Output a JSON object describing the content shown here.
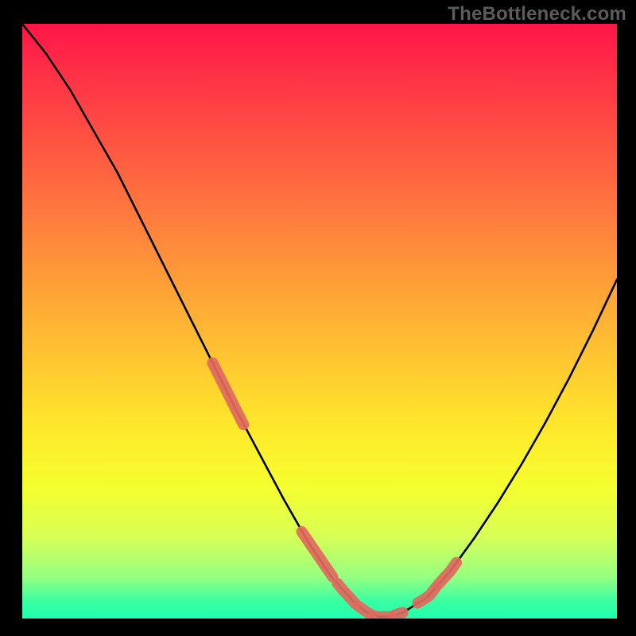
{
  "watermark": "TheBottleneck.com",
  "chart_data": {
    "type": "line",
    "title": "",
    "xlabel": "",
    "ylabel": "",
    "xlim": [
      0,
      100
    ],
    "ylim": [
      0,
      100
    ],
    "series": [
      {
        "name": "curve",
        "x": [
          0,
          4,
          8,
          12,
          16,
          20,
          24,
          28,
          32,
          36,
          40,
          44,
          48,
          52,
          56,
          58,
          60,
          62,
          64,
          68,
          72,
          76,
          80,
          84,
          88,
          92,
          96,
          100
        ],
        "y": [
          100,
          95,
          89,
          82,
          75,
          67,
          59,
          51,
          43,
          35,
          27.5,
          20,
          13,
          7,
          2.5,
          1,
          0.3,
          0.3,
          1,
          3.5,
          8,
          13.5,
          19.5,
          26,
          33,
          40.5,
          48.5,
          57
        ]
      },
      {
        "name": "highlight-segments",
        "segments": [
          {
            "x": [
              32.0,
              33.3,
              34.6,
              35.9,
              37.2
            ],
            "y": [
              43.0,
              40.4,
              37.8,
              35.2,
              32.6
            ]
          },
          {
            "x": [
              47.0,
              48.3,
              49.6,
              50.9,
              52.2
            ],
            "y": [
              14.6,
              12.7,
              10.8,
              8.9,
              7.0
            ]
          },
          {
            "x": [
              53.0,
              54.0,
              55.0,
              56.0
            ],
            "y": [
              5.9,
              4.7,
              3.6,
              2.5
            ]
          },
          {
            "x": [
              56.5,
              57.2,
              57.9,
              58.6
            ],
            "y": [
              2.1,
              1.6,
              1.1,
              0.7
            ]
          },
          {
            "x": [
              59.0,
              60.0,
              61.0,
              62.0
            ],
            "y": [
              0.4,
              0.3,
              0.3,
              0.3
            ]
          },
          {
            "x": [
              62.5,
              63.0,
              63.5,
              64.0
            ],
            "y": [
              0.5,
              0.7,
              0.9,
              1.0
            ]
          },
          {
            "x": [
              66.5,
              67.5,
              68.5,
              69.5
            ],
            "y": [
              2.6,
              3.2,
              3.9,
              5.2
            ]
          },
          {
            "x": [
              70.0,
              71.0,
              72.0,
              73.0
            ],
            "y": [
              5.8,
              6.9,
              8.0,
              9.4
            ]
          }
        ]
      }
    ],
    "gradient_stops": [
      {
        "pos": 0.0,
        "color": "#ff1547"
      },
      {
        "pos": 0.2,
        "color": "#ff5442"
      },
      {
        "pos": 0.44,
        "color": "#ffa037"
      },
      {
        "pos": 0.68,
        "color": "#ffe82b"
      },
      {
        "pos": 0.86,
        "color": "#d9ff55"
      },
      {
        "pos": 1.0,
        "color": "#1effb0"
      }
    ],
    "highlight_color": "#e0695e",
    "curve_color": "#000000"
  }
}
